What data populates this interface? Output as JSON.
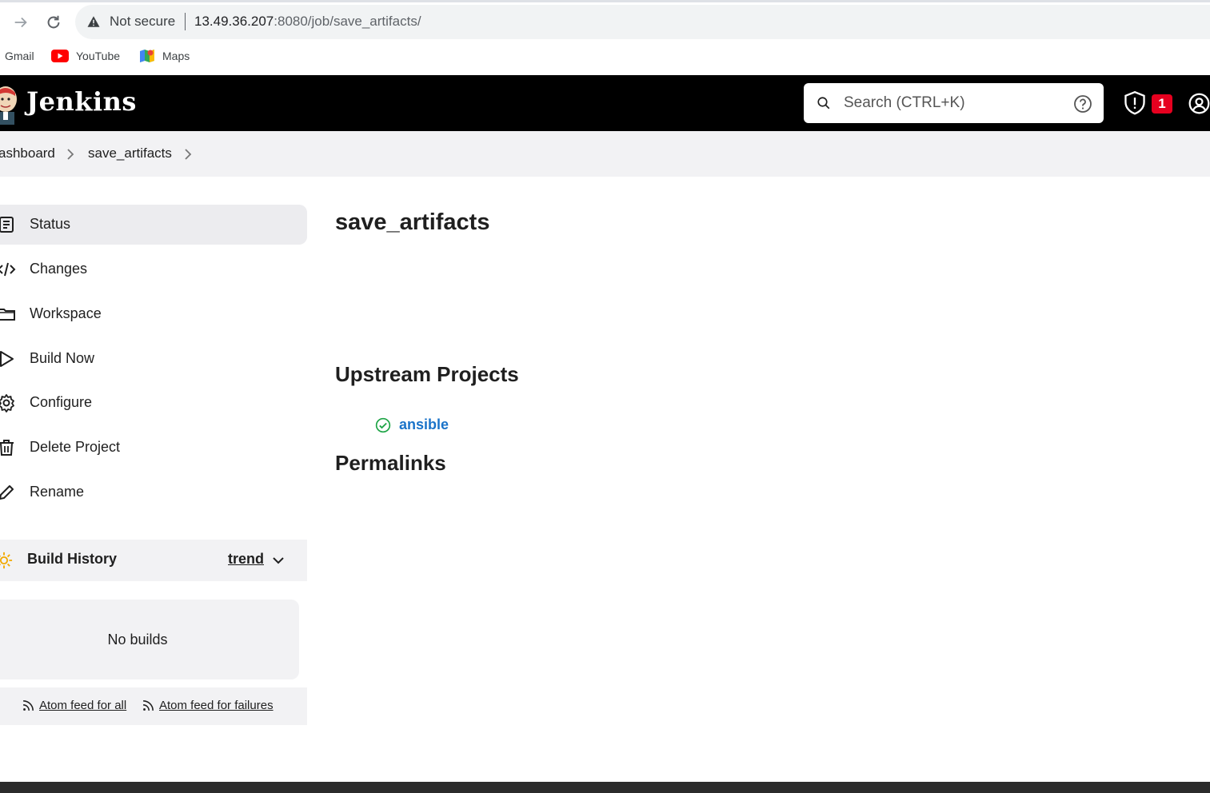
{
  "browser": {
    "security_label": "Not secure",
    "url_host": "13.49.36.207",
    "url_rest": ":8080/job/save_artifacts/",
    "bookmarks": [
      {
        "label": "Gmail"
      },
      {
        "label": "YouTube"
      },
      {
        "label": "Maps"
      }
    ]
  },
  "header": {
    "title": "Jenkins",
    "search_placeholder": "Search (CTRL+K)",
    "alert_count": "1"
  },
  "breadcrumb": {
    "items": [
      "ashboard",
      "save_artifacts"
    ]
  },
  "sidebar": {
    "tasks": [
      {
        "label": "Status",
        "icon": "status-icon"
      },
      {
        "label": "Changes",
        "icon": "code-icon"
      },
      {
        "label": "Workspace",
        "icon": "folder-icon"
      },
      {
        "label": "Build Now",
        "icon": "play-icon"
      },
      {
        "label": "Configure",
        "icon": "gear-icon"
      },
      {
        "label": "Delete Project",
        "icon": "trash-icon"
      },
      {
        "label": "Rename",
        "icon": "pencil-icon"
      }
    ],
    "build_history": {
      "title": "Build History",
      "trend_label": "trend",
      "empty_label": "No builds"
    },
    "feeds": {
      "all_label": "Atom feed for all",
      "failures_label": "Atom feed for failures"
    }
  },
  "main": {
    "title": "save_artifacts",
    "upstream_heading": "Upstream Projects",
    "upstream_projects": [
      {
        "name": "ansible",
        "status": "success"
      }
    ],
    "permalinks_heading": "Permalinks"
  },
  "colors": {
    "header_bg": "#000000",
    "link": "#1a73c9",
    "success": "#1ea446",
    "alert": "#e6001f"
  }
}
